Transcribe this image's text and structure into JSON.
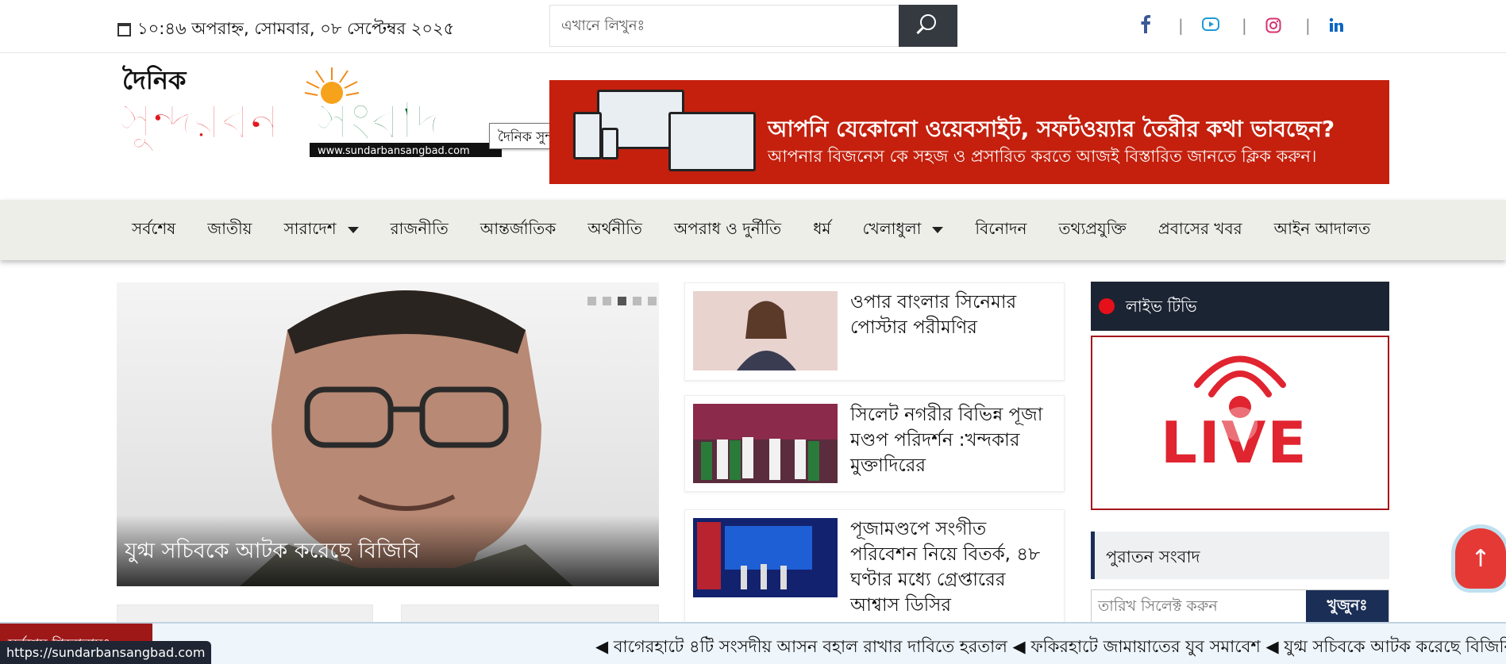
{
  "topbar": {
    "datetime": "১০:৪৬ অপরাহ্ন, সোমবার, ০৮ সেপ্টেম্বর ২০২৫",
    "search_placeholder": "এখানে লিখুনঃ",
    "social": [
      "facebook-icon",
      "youtube-icon",
      "instagram-icon",
      "linkedin-icon"
    ],
    "social_colors": {
      "facebook": "#3b5998",
      "youtube": "#1e9bd7",
      "instagram": "#d6336c",
      "linkedin": "#0a66c2"
    },
    "separator": "|"
  },
  "logo": {
    "top": "দৈনিক",
    "main": "সুন্দরবনসংবাদ",
    "url": "www.sundarbansangbad.com",
    "tooltip": "দৈনিক সুন্দরবন সংবাদ"
  },
  "ad": {
    "line1": "আপনি যেকোনো ওয়েবসাইট, সফটওয়্যার তৈরীর কথা ভাবছেন?",
    "line2": "আপনার বিজনেস কে সহজ ও প্রসারিত করতে আজই বিস্তারিত জানতে ক্লিক করুন।"
  },
  "nav": {
    "items": [
      {
        "label": "সর্বশেষ",
        "dropdown": false
      },
      {
        "label": "জাতীয়",
        "dropdown": false
      },
      {
        "label": "সারাদেশ",
        "dropdown": true
      },
      {
        "label": "রাজনীতি",
        "dropdown": false
      },
      {
        "label": "আন্তর্জাতিক",
        "dropdown": false
      },
      {
        "label": "অর্থনীতি",
        "dropdown": false
      },
      {
        "label": "অপরাধ ও দুর্নীতি",
        "dropdown": false
      },
      {
        "label": "ধর্ম",
        "dropdown": false
      },
      {
        "label": "খেলাধুলা",
        "dropdown": true
      },
      {
        "label": "বিনোদন",
        "dropdown": false
      },
      {
        "label": "তথ্যপ্রযুক্তি",
        "dropdown": false
      },
      {
        "label": "প্রবাসের খবর",
        "dropdown": false
      },
      {
        "label": "আইন আদালত",
        "dropdown": false
      }
    ]
  },
  "hero": {
    "title": "যুগ্ম সচিবকে আটক করেছে বিজিবি",
    "active_slide": 3,
    "slide_count": 5
  },
  "news": [
    {
      "title": "ওপার বাংলার সিনেমার পোস্টার পরীমণির"
    },
    {
      "title": "সিলেট নগরীর বিভিন্ন পূজা মণ্ডপ পরিদর্শন :খন্দকার মুক্তাদিরের"
    },
    {
      "title": "পূজামণ্ডপে সংগীত পরিবেশন নিয়ে বিতর্ক, ৪৮ ঘণ্টার মধ্যে গ্রেপ্তারের আশ্বাস ডিসির"
    }
  ],
  "sidebar": {
    "live_title": "লাইভ টিভি",
    "live_text": "LIVE",
    "archive_title": "পুরাতন সংবাদ",
    "date_placeholder": "তারিখ সিলেক্ট করুন",
    "find_label": "খুজুনঃ"
  },
  "back_to_top": "↑",
  "ticker": {
    "label": "সর্বশেষ শিরোনামঃ",
    "text": "◀ বাগেরহাটে ৪টি সংসদীয় আসন বহাল রাখার দাবিতে হরতাল ◀ ফকিরহাটে জামায়াতের যুব সমাবেশ ◀ যুগ্ম সচিবকে আটক করেছে বিজিবি"
  },
  "status_url": "https://sundarbansangbad.com"
}
